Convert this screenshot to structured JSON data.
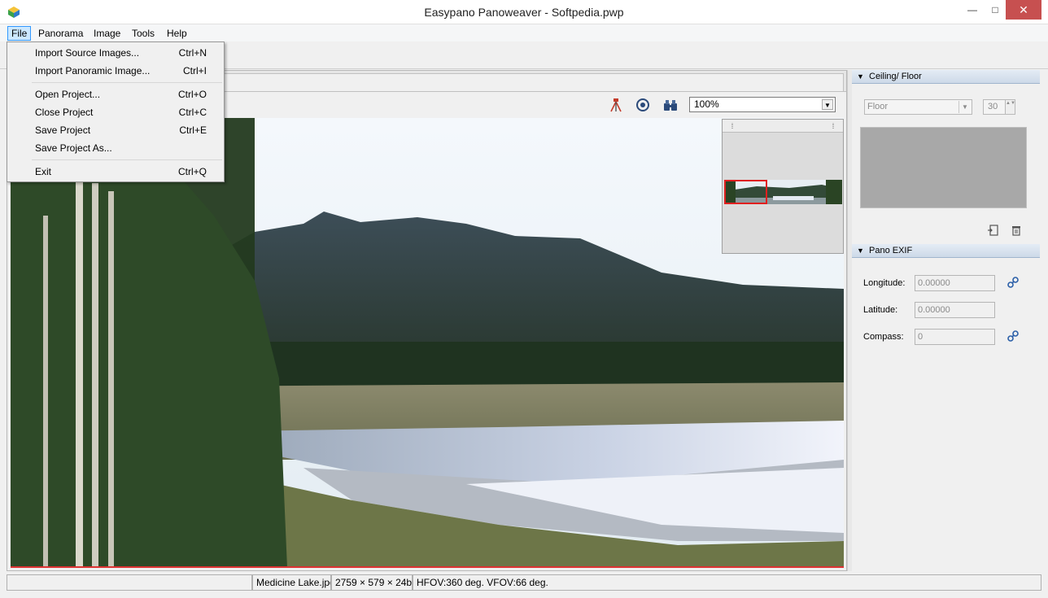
{
  "window": {
    "title": "Easypano Panoweaver - Softpedia.pwp",
    "minimize": "—",
    "maximize": "□",
    "close": "✕"
  },
  "menubar": [
    "File",
    "Panorama",
    "Image",
    "Tools",
    "Help"
  ],
  "file_menu": {
    "items": [
      {
        "label": "Import Source Images...",
        "shortcut": "Ctrl+N"
      },
      {
        "label": "Import Panoramic Image...",
        "shortcut": "Ctrl+I"
      },
      {
        "label": "Open Project...",
        "shortcut": "Ctrl+O"
      },
      {
        "label": "Close Project",
        "shortcut": "Ctrl+C"
      },
      {
        "label": "Save Project",
        "shortcut": "Ctrl+E"
      },
      {
        "label": "Save Project As...",
        "shortcut": ""
      },
      {
        "label": "Exit",
        "shortcut": "Ctrl+Q"
      }
    ]
  },
  "view_toolbar": {
    "icons": [
      "tripod-icon",
      "target-icon",
      "binoculars-icon"
    ],
    "zoom": "100%",
    "zoom_arrow": "▼"
  },
  "navigator": {
    "icons": [
      "expand-icon",
      "resize-icon"
    ]
  },
  "ceiling_floor": {
    "header": "Ceiling/ Floor",
    "toggle": "▼",
    "select_value": "Floor",
    "select_arrow": "▼",
    "spin_value": "30",
    "spin_arrows": "▲▼",
    "icons": [
      "import-icon",
      "trash-icon"
    ]
  },
  "pano_exif": {
    "header": "Pano EXIF",
    "toggle": "▼",
    "fields": [
      {
        "label": "Longitude:",
        "value": "0.00000",
        "icon": "link-icon"
      },
      {
        "label": "Latitude:",
        "value": "0.00000",
        "icon": ""
      },
      {
        "label": "Compass:",
        "value": "0",
        "icon": "link-icon"
      }
    ]
  },
  "statusbar": {
    "filename": "Medicine Lake.jpg",
    "dimensions": "2759 × 579 × 24b",
    "fov": "HFOV:360 deg. VFOV:66 deg."
  },
  "colors": {
    "accent": "#3399ff",
    "close_button": "#c75050",
    "selection_frame": "#e02020",
    "section_header_border": "#9fb5cd"
  }
}
